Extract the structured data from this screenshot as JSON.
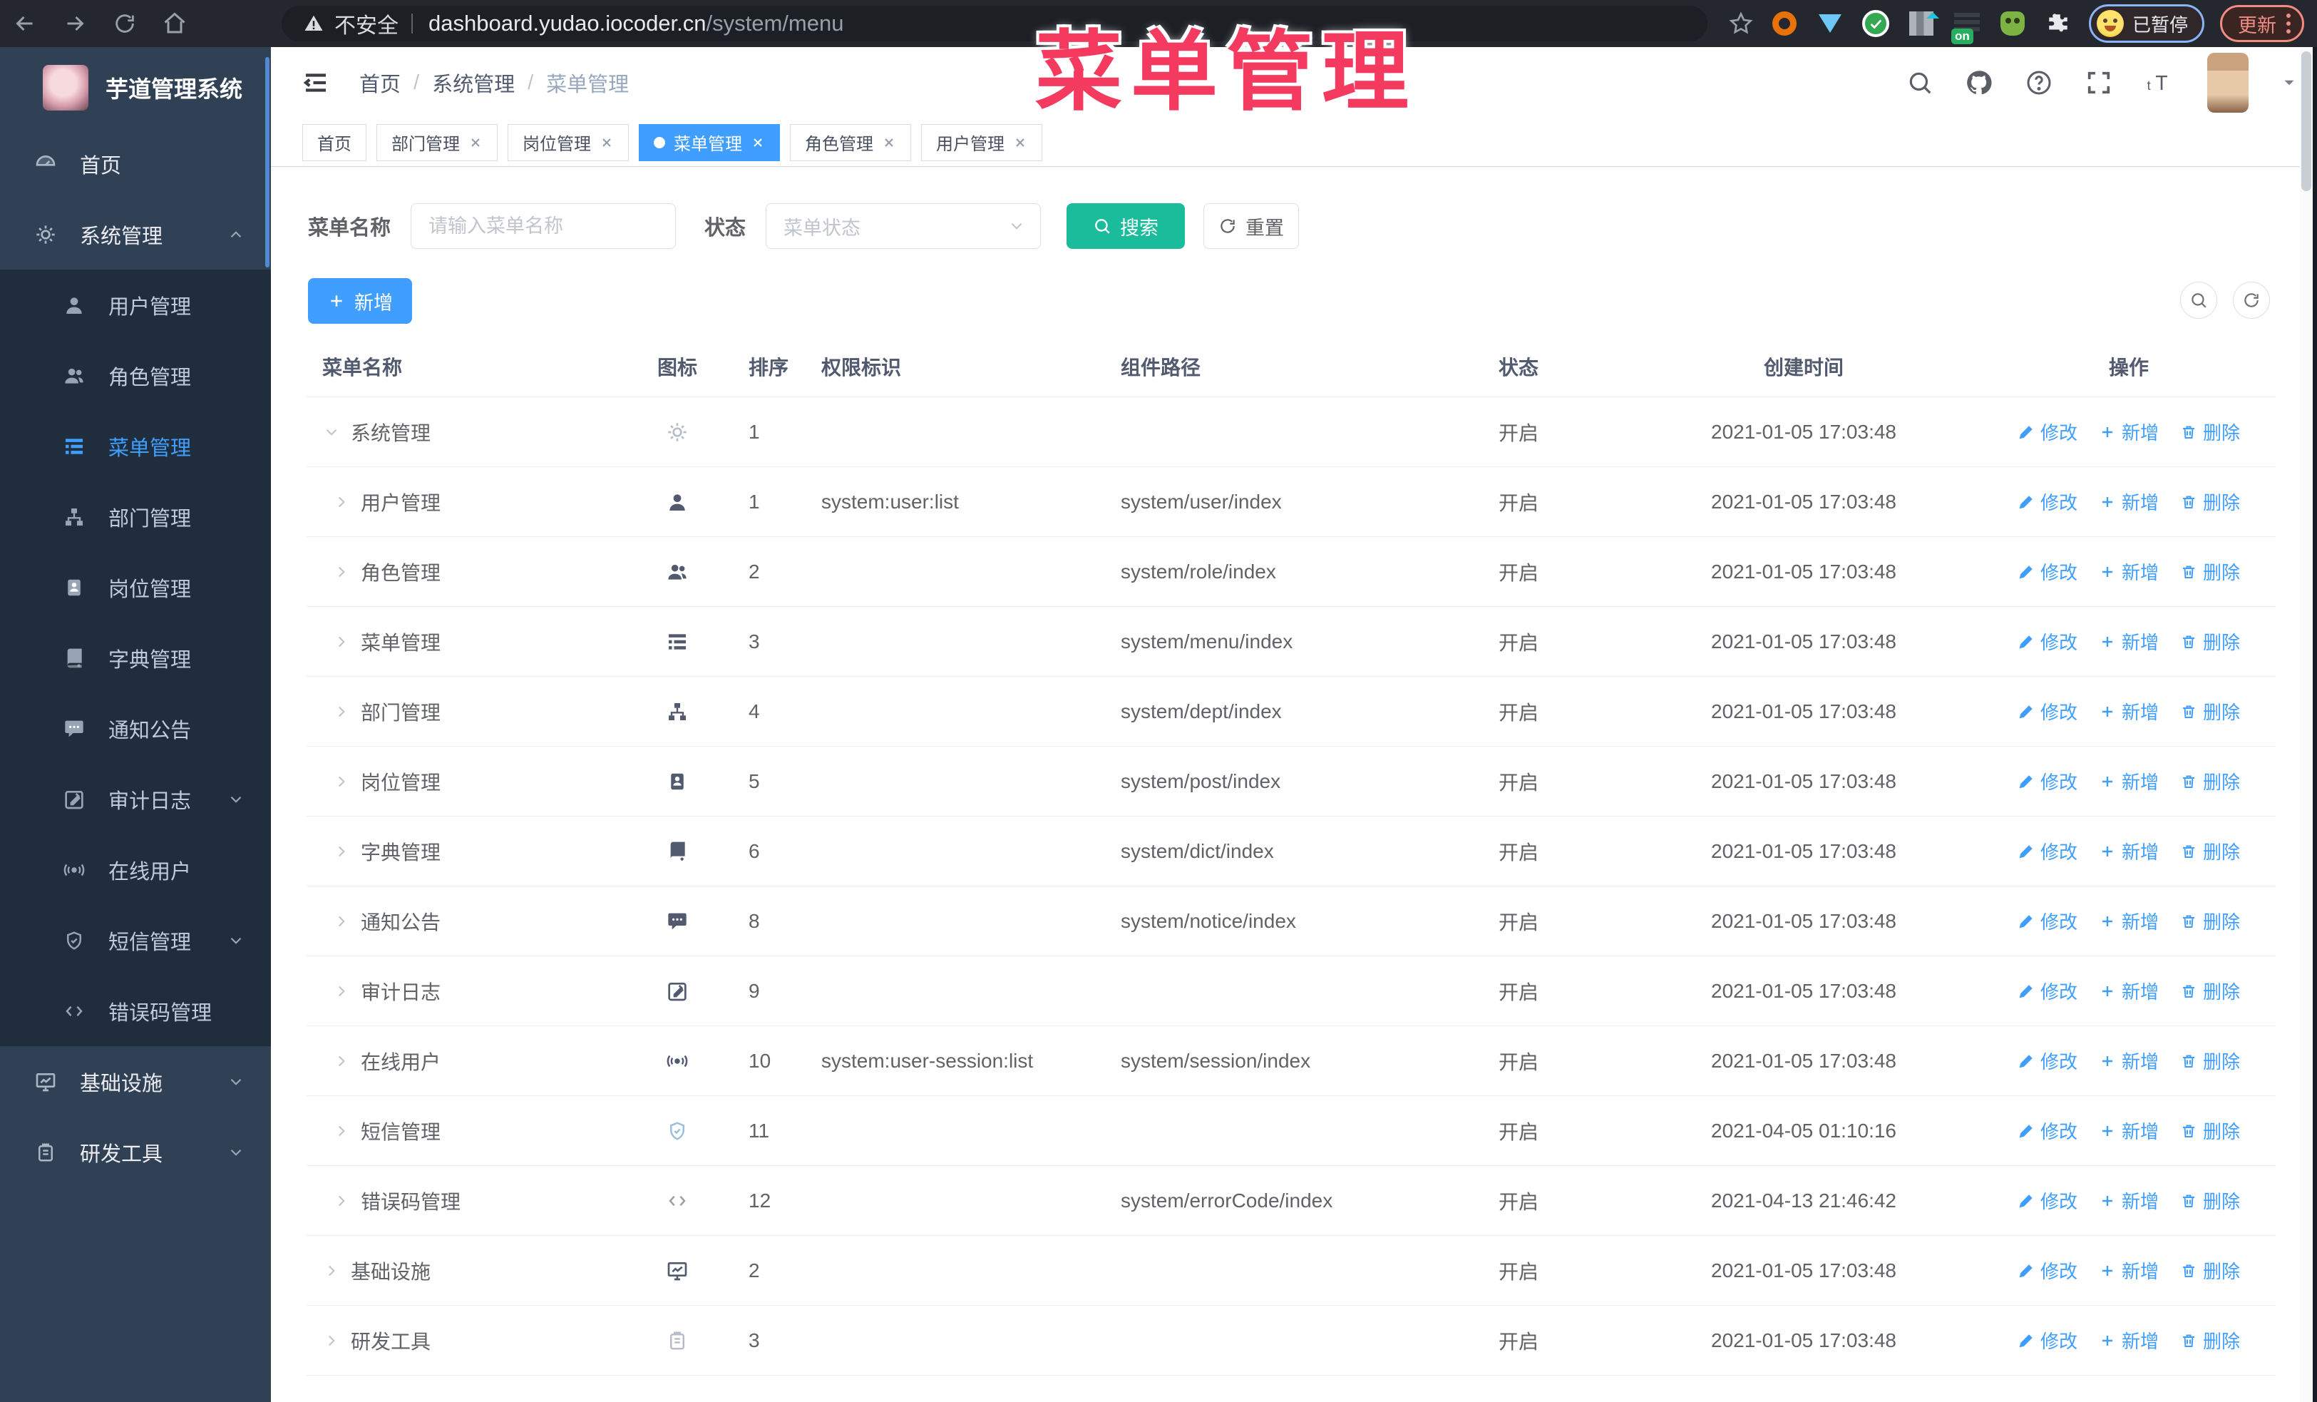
{
  "browser": {
    "security_label": "不安全",
    "url_host": "dashboard.yudao.iocoder.cn",
    "url_path": "/system/menu",
    "profile_badge": "已暂停",
    "update_label": "更新"
  },
  "annotation": {
    "text": "菜单管理",
    "color": "#f43b5f"
  },
  "sidebar": {
    "title": "芋道管理系统",
    "items": [
      {
        "label": "首页",
        "icon": "dashboard",
        "level": "root"
      },
      {
        "label": "系统管理",
        "icon": "gear",
        "level": "root",
        "chevron": "up"
      },
      {
        "label": "用户管理",
        "icon": "user",
        "level": "sub"
      },
      {
        "label": "角色管理",
        "icon": "users",
        "level": "sub"
      },
      {
        "label": "菜单管理",
        "icon": "tree-table",
        "level": "sub",
        "active": true
      },
      {
        "label": "部门管理",
        "icon": "tree",
        "level": "sub"
      },
      {
        "label": "岗位管理",
        "icon": "post",
        "level": "sub"
      },
      {
        "label": "字典管理",
        "icon": "dict",
        "level": "sub"
      },
      {
        "label": "通知公告",
        "icon": "message",
        "level": "sub"
      },
      {
        "label": "审计日志",
        "icon": "log",
        "level": "sub",
        "chevron": "down"
      },
      {
        "label": "在线用户",
        "icon": "online",
        "level": "sub"
      },
      {
        "label": "短信管理",
        "icon": "sms",
        "level": "sub",
        "chevron": "down"
      },
      {
        "label": "错误码管理",
        "icon": "code",
        "level": "sub"
      },
      {
        "label": "基础设施",
        "icon": "monitor",
        "level": "root",
        "chevron": "down"
      },
      {
        "label": "研发工具",
        "icon": "clipboard",
        "level": "root",
        "chevron": "down"
      }
    ]
  },
  "breadcrumb": [
    "首页",
    "系统管理",
    "菜单管理"
  ],
  "tabs": [
    {
      "label": "首页",
      "closable": false,
      "active": false
    },
    {
      "label": "部门管理",
      "closable": true,
      "active": false
    },
    {
      "label": "岗位管理",
      "closable": true,
      "active": false
    },
    {
      "label": "菜单管理",
      "closable": true,
      "active": true
    },
    {
      "label": "角色管理",
      "closable": true,
      "active": false
    },
    {
      "label": "用户管理",
      "closable": true,
      "active": false
    }
  ],
  "filters": {
    "name_label": "菜单名称",
    "name_placeholder": "请输入菜单名称",
    "status_label": "状态",
    "status_placeholder": "菜单状态",
    "search_label": "搜索",
    "reset_label": "重置",
    "add_label": "新增"
  },
  "table": {
    "columns": [
      "菜单名称",
      "图标",
      "排序",
      "权限标识",
      "组件路径",
      "状态",
      "创建时间",
      "操作"
    ],
    "actions": {
      "edit": "修改",
      "add": "新增",
      "delete": "删除"
    },
    "rows": [
      {
        "name": "系统管理",
        "icon": "gear",
        "icon_tone": "ic-muted",
        "level": 0,
        "expanded": true,
        "sort": "1",
        "perm": "",
        "path": "",
        "status": "开启",
        "created": "2021-01-05 17:03:48"
      },
      {
        "name": "用户管理",
        "icon": "user",
        "icon_tone": "",
        "level": 1,
        "expanded": false,
        "sort": "1",
        "perm": "system:user:list",
        "path": "system/user/index",
        "status": "开启",
        "created": "2021-01-05 17:03:48"
      },
      {
        "name": "角色管理",
        "icon": "users",
        "icon_tone": "",
        "level": 1,
        "expanded": false,
        "sort": "2",
        "perm": "",
        "path": "system/role/index",
        "status": "开启",
        "created": "2021-01-05 17:03:48"
      },
      {
        "name": "菜单管理",
        "icon": "tree-table",
        "icon_tone": "",
        "level": 1,
        "expanded": false,
        "sort": "3",
        "perm": "",
        "path": "system/menu/index",
        "status": "开启",
        "created": "2021-01-05 17:03:48"
      },
      {
        "name": "部门管理",
        "icon": "tree",
        "icon_tone": "",
        "level": 1,
        "expanded": false,
        "sort": "4",
        "perm": "",
        "path": "system/dept/index",
        "status": "开启",
        "created": "2021-01-05 17:03:48"
      },
      {
        "name": "岗位管理",
        "icon": "post",
        "icon_tone": "",
        "level": 1,
        "expanded": false,
        "sort": "5",
        "perm": "",
        "path": "system/post/index",
        "status": "开启",
        "created": "2021-01-05 17:03:48"
      },
      {
        "name": "字典管理",
        "icon": "dict",
        "icon_tone": "",
        "level": 1,
        "expanded": false,
        "sort": "6",
        "perm": "",
        "path": "system/dict/index",
        "status": "开启",
        "created": "2021-01-05 17:03:48"
      },
      {
        "name": "通知公告",
        "icon": "message",
        "icon_tone": "",
        "level": 1,
        "expanded": false,
        "sort": "8",
        "perm": "",
        "path": "system/notice/index",
        "status": "开启",
        "created": "2021-01-05 17:03:48"
      },
      {
        "name": "审计日志",
        "icon": "log",
        "icon_tone": "",
        "level": 1,
        "expanded": false,
        "sort": "9",
        "perm": "",
        "path": "",
        "status": "开启",
        "created": "2021-01-05 17:03:48"
      },
      {
        "name": "在线用户",
        "icon": "online",
        "icon_tone": "",
        "level": 1,
        "expanded": false,
        "sort": "10",
        "perm": "system:user-session:list",
        "path": "system/session/index",
        "status": "开启",
        "created": "2021-01-05 17:03:48"
      },
      {
        "name": "短信管理",
        "icon": "sms",
        "icon_tone": "ic-soft",
        "level": 1,
        "expanded": false,
        "sort": "11",
        "perm": "",
        "path": "",
        "status": "开启",
        "created": "2021-04-05 01:10:16"
      },
      {
        "name": "错误码管理",
        "icon": "code",
        "icon_tone": "ic-gray",
        "level": 1,
        "expanded": false,
        "sort": "12",
        "perm": "",
        "path": "system/errorCode/index",
        "status": "开启",
        "created": "2021-04-13 21:46:42"
      },
      {
        "name": "基础设施",
        "icon": "monitor",
        "icon_tone": "",
        "level": 0,
        "expanded": false,
        "sort": "2",
        "perm": "",
        "path": "",
        "status": "开启",
        "created": "2021-01-05 17:03:48"
      },
      {
        "name": "研发工具",
        "icon": "clipboard",
        "icon_tone": "ic-muted",
        "level": 0,
        "expanded": false,
        "sort": "3",
        "perm": "",
        "path": "",
        "status": "开启",
        "created": "2021-01-05 17:03:48"
      }
    ]
  }
}
